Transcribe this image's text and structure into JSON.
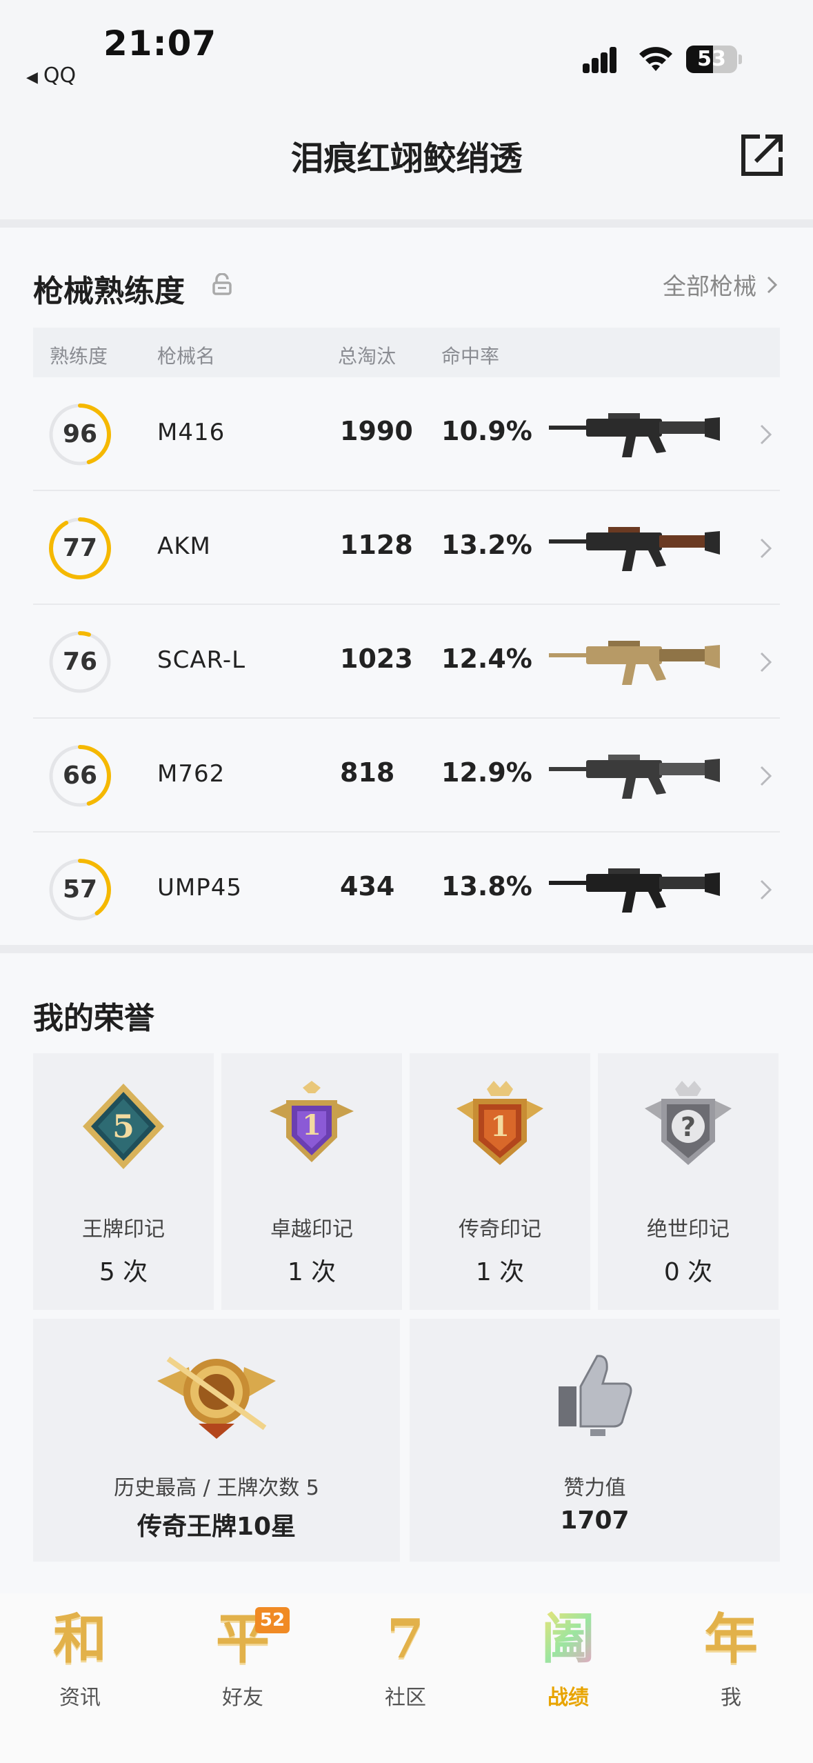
{
  "status_bar": {
    "time": "21:07",
    "back_app": "QQ",
    "battery": "53",
    "battery_level": 0.53
  },
  "header": {
    "title": "泪痕红翊鲛绡透"
  },
  "weapons": {
    "title": "枪械熟练度",
    "all_link": "全部枪械",
    "columns": {
      "mastery": "熟练度",
      "name": "枪械名",
      "kills": "总淘汰",
      "accuracy": "命中率"
    },
    "rows": [
      {
        "mastery": "96",
        "progress": 0.45,
        "name": "M416",
        "kills": "1990",
        "accuracy": "10.9%",
        "gun": "m416-rifle-icon"
      },
      {
        "mastery": "77",
        "progress": 0.92,
        "name": "AKM",
        "kills": "1128",
        "accuracy": "13.2%",
        "gun": "akm-rifle-icon"
      },
      {
        "mastery": "76",
        "progress": 0.05,
        "name": "SCAR-L",
        "kills": "1023",
        "accuracy": "12.4%",
        "gun": "scar-l-rifle-icon"
      },
      {
        "mastery": "66",
        "progress": 0.45,
        "name": "M762",
        "kills": "818",
        "accuracy": "12.9%",
        "gun": "m762-rifle-icon"
      },
      {
        "mastery": "57",
        "progress": 0.4,
        "name": "UMP45",
        "kills": "434",
        "accuracy": "13.8%",
        "gun": "ump45-smg-icon"
      }
    ]
  },
  "honors": {
    "title": "我的荣誉",
    "marks": [
      {
        "label": "王牌印记",
        "count": "5 次",
        "badge": "ace-mark-badge-icon",
        "badge_text": "5"
      },
      {
        "label": "卓越印记",
        "count": "1 次",
        "badge": "excellence-mark-badge-icon",
        "badge_text": "1"
      },
      {
        "label": "传奇印记",
        "count": "1 次",
        "badge": "legend-mark-badge-icon",
        "badge_text": "1"
      },
      {
        "label": "绝世印记",
        "count": "0 次",
        "badge": "peerless-mark-badge-icon",
        "badge_text": "?"
      }
    ],
    "highest": {
      "label": "历史最高 / 王牌次数 5",
      "value": "传奇王牌10星"
    },
    "likes": {
      "label": "赞力值",
      "value": "1707"
    }
  },
  "tabs": [
    {
      "icon_char": "和",
      "label": "资讯"
    },
    {
      "icon_char": "平",
      "label": "好友",
      "badge": "52"
    },
    {
      "icon_char": "7",
      "label": "社区"
    },
    {
      "icon_char": "阖",
      "label": "战绩",
      "active": true
    },
    {
      "icon_char": "年",
      "label": "我"
    }
  ],
  "colors": {
    "accent": "#f5b800",
    "ring_track": "#e4e5e8",
    "tab_active": "#e8a400",
    "badge": "#f08a24"
  }
}
